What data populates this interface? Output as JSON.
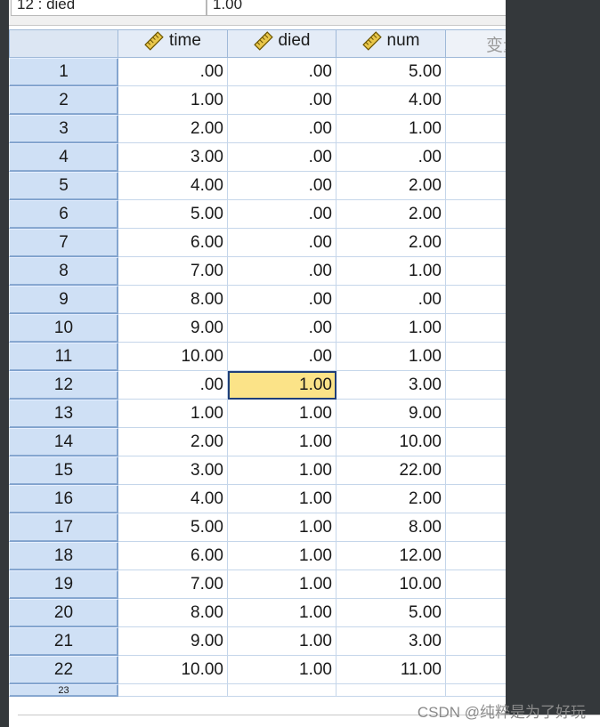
{
  "cell_ref": {
    "name": "12 : died",
    "value": "1.00"
  },
  "header": {
    "columns": [
      "time",
      "died",
      "num"
    ],
    "ghost_column": "变量",
    "icon": "ruler-icon"
  },
  "rows": [
    {
      "num": "1",
      "time": ".00",
      "died": ".00",
      "count": "5.00"
    },
    {
      "num": "2",
      "time": "1.00",
      "died": ".00",
      "count": "4.00"
    },
    {
      "num": "3",
      "time": "2.00",
      "died": ".00",
      "count": "1.00"
    },
    {
      "num": "4",
      "time": "3.00",
      "died": ".00",
      "count": ".00"
    },
    {
      "num": "5",
      "time": "4.00",
      "died": ".00",
      "count": "2.00"
    },
    {
      "num": "6",
      "time": "5.00",
      "died": ".00",
      "count": "2.00"
    },
    {
      "num": "7",
      "time": "6.00",
      "died": ".00",
      "count": "2.00"
    },
    {
      "num": "8",
      "time": "7.00",
      "died": ".00",
      "count": "1.00"
    },
    {
      "num": "9",
      "time": "8.00",
      "died": ".00",
      "count": ".00"
    },
    {
      "num": "10",
      "time": "9.00",
      "died": ".00",
      "count": "1.00"
    },
    {
      "num": "11",
      "time": "10.00",
      "died": ".00",
      "count": "1.00"
    },
    {
      "num": "12",
      "time": ".00",
      "died": "1.00",
      "count": "3.00"
    },
    {
      "num": "13",
      "time": "1.00",
      "died": "1.00",
      "count": "9.00"
    },
    {
      "num": "14",
      "time": "2.00",
      "died": "1.00",
      "count": "10.00"
    },
    {
      "num": "15",
      "time": "3.00",
      "died": "1.00",
      "count": "22.00"
    },
    {
      "num": "16",
      "time": "4.00",
      "died": "1.00",
      "count": "2.00"
    },
    {
      "num": "17",
      "time": "5.00",
      "died": "1.00",
      "count": "8.00"
    },
    {
      "num": "18",
      "time": "6.00",
      "died": "1.00",
      "count": "12.00"
    },
    {
      "num": "19",
      "time": "7.00",
      "died": "1.00",
      "count": "10.00"
    },
    {
      "num": "20",
      "time": "8.00",
      "died": "1.00",
      "count": "5.00"
    },
    {
      "num": "21",
      "time": "9.00",
      "died": "1.00",
      "count": "3.00"
    },
    {
      "num": "22",
      "time": "10.00",
      "died": "1.00",
      "count": "11.00"
    }
  ],
  "partial_row": "23",
  "selected": {
    "row": 12,
    "column": "died"
  },
  "colors": {
    "selected_cell": "#fbe388",
    "row_header": "#cfe0f5",
    "background": "#34383b"
  },
  "watermark": "CSDN @纯粹是为了好玩"
}
